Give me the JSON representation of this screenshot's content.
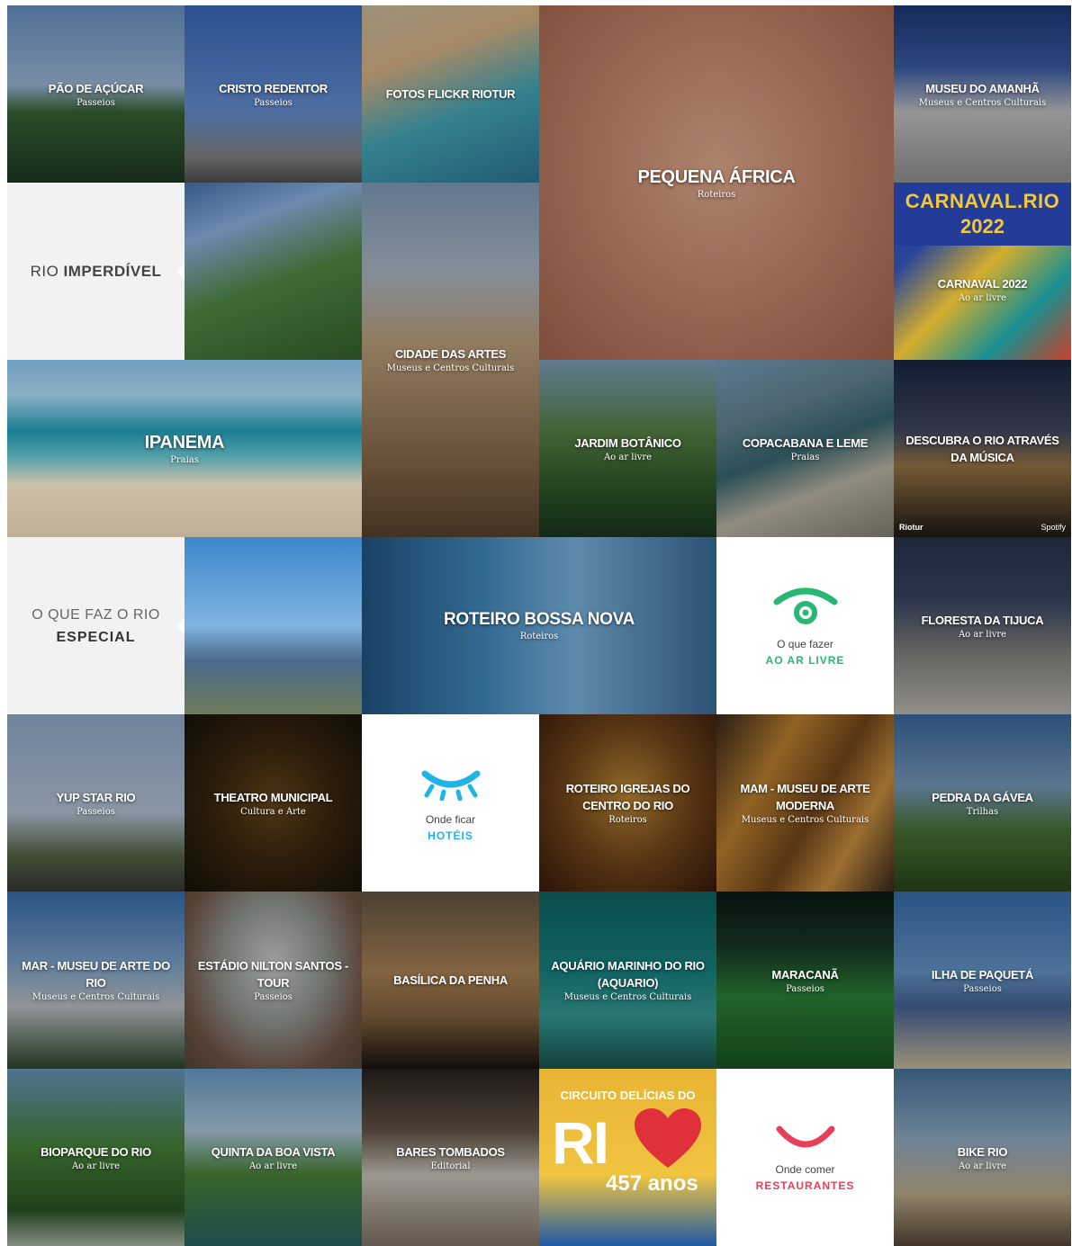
{
  "tiles": {
    "pao_de_acucar": {
      "title": "PÃO DE AÇÚCAR",
      "subtitle": "Passeios"
    },
    "cristo_redentor": {
      "title": "CRISTO REDENTOR",
      "subtitle": "Passeios"
    },
    "fotos_flickr": {
      "title": "FOTOS FLICKR RIOTUR"
    },
    "pequena_africa": {
      "title": "PEQUENA ÁFRICA",
      "subtitle": "Roteiros"
    },
    "museu_amanha": {
      "title": "MUSEU DO AMANHÃ",
      "subtitle": "Museus e Centros Culturais"
    },
    "rio_imperdivel": {
      "part1": "RIO",
      "part2": "IMPERDÍVEL"
    },
    "cidade_artes": {
      "title": "CIDADE DAS ARTES",
      "subtitle": "Museus e Centros Culturais"
    },
    "carnaval": {
      "brand_line1": "CARNAVAL.RIO",
      "brand_line2": "2022",
      "title": "CARNAVAL 2022",
      "subtitle": "Ao ar livre"
    },
    "ipanema": {
      "title": "IPANEMA",
      "subtitle": "Praias"
    },
    "jardim_botanico": {
      "title": "JARDIM BOTÂNICO",
      "subtitle": "Ao ar livre"
    },
    "copacabana": {
      "title": "COPACABANA E LEME",
      "subtitle": "Praias"
    },
    "musica": {
      "title": "DESCUBRA O RIO ATRAVÉS DA MÚSICA",
      "logo_left": "Riotur",
      "logo_right": "Spotify"
    },
    "o_que_faz": {
      "line1": "O QUE FAZ O RIO",
      "line2": "ESPECIAL"
    },
    "bossa_nova": {
      "title": "ROTEIRO BOSSA NOVA",
      "subtitle": "Roteiros"
    },
    "ar_livre": {
      "line1": "O que fazer",
      "line2": "AO AR LIVRE",
      "color": "#2ab673"
    },
    "floresta_tijuca": {
      "title": "FLORESTA DA TIJUCA",
      "subtitle": "Ao ar livre"
    },
    "yup_star": {
      "title": "YUP STAR RIO",
      "subtitle": "Passeios"
    },
    "theatro": {
      "title": "THEATRO MUNICIPAL",
      "subtitle": "Cultura e Arte"
    },
    "hoteis": {
      "line1": "Onde ficar",
      "line2": "HOTÉIS",
      "color": "#1fb3e6"
    },
    "igrejas": {
      "title": "ROTEIRO IGREJAS DO CENTRO DO RIO",
      "subtitle": "Roteiros"
    },
    "mam": {
      "title": "MAM - MUSEU DE ARTE MODERNA",
      "subtitle": "Museus e Centros Culturais"
    },
    "pedra_gavea": {
      "title": "PEDRA DA GÁVEA",
      "subtitle": "Trilhas"
    },
    "mar": {
      "title": "MAR - MUSEU DE ARTE DO RIO",
      "subtitle": "Museus e Centros Culturais"
    },
    "estadio": {
      "title": "ESTÁDIO NILTON SANTOS - TOUR",
      "subtitle": "Passeios"
    },
    "penha": {
      "title": "BASÍLICA DA PENHA"
    },
    "aquario": {
      "title": "AQUÁRIO MARINHO DO RIO (AQUARIO)",
      "subtitle": "Museus e Centros Culturais"
    },
    "maracana": {
      "title": "MARACANÃ",
      "subtitle": "Passeios"
    },
    "paqueta": {
      "title": "ILHA DE PAQUETÁ",
      "subtitle": "Passeios"
    },
    "bioparque": {
      "title": "BIOPARQUE DO RIO",
      "subtitle": "Ao ar livre"
    },
    "quinta": {
      "title": "QUINTA DA BOA VISTA",
      "subtitle": "Ao ar livre"
    },
    "bares": {
      "title": "BARES TOMBADOS",
      "subtitle": "Editorial"
    },
    "delicias": {
      "line1": "CIRCUITO DELÍCIAS DO",
      "word": "RI",
      "anos": "457 anos"
    },
    "restaurantes": {
      "line1": "Onde comer",
      "line2": "RESTAURANTES",
      "color": "#e8405a"
    },
    "bike": {
      "title": "BIKE RIO",
      "subtitle": "Ao ar livre"
    }
  },
  "icons": {
    "eye": "eye-icon",
    "closed_eye": "closed-eye-icon",
    "smile": "smile-icon",
    "heart": "heart-icon"
  }
}
